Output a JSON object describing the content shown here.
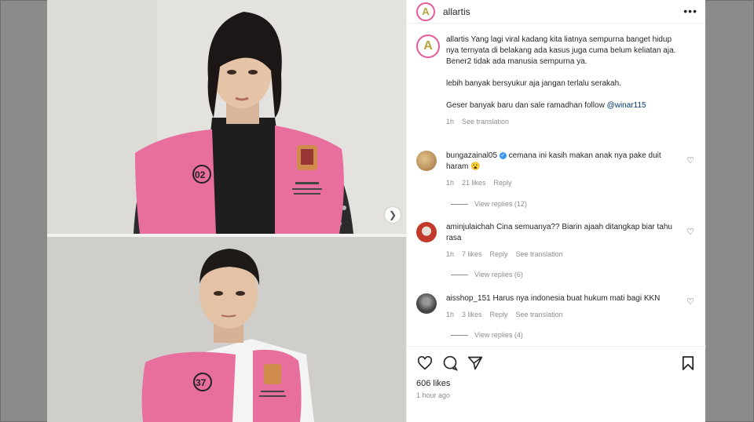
{
  "post": {
    "username": "allartis",
    "avatar_letter": "A",
    "more_icon": "more-horizontal-icon",
    "caption": {
      "username": "allartis",
      "line1": "Yang lagi viral kadang kita liatnya sempurna banget hidup nya ternyata di belakang ada kasus juga cuma belum keliatan aja.",
      "line2": "Bener2 tidak ada manusia sempurna ya.",
      "line3": "lebih banyak bersyukur aja jangan terlalu serakah.",
      "line4_prefix": "Geser banyak baru dan sale ramadhan follow ",
      "line4_mention": "@winar115",
      "time": "1h",
      "translation": "See translation"
    },
    "comments": [
      {
        "username": "bungazainal05",
        "verified": true,
        "text": "cemana ini kasih makan anak nya pake duit haram 😮",
        "time": "1h",
        "likes": "21 likes",
        "reply": "Reply",
        "translation": "",
        "view_replies": "View replies (12)",
        "avatar_color": "#c9a36b"
      },
      {
        "username": "aminjulaichah",
        "verified": false,
        "text": "Cina semuanya?? Biarin ajaah ditangkap biar tahu rasa",
        "time": "1h",
        "likes": "7 likes",
        "reply": "Reply",
        "translation": "See translation",
        "view_replies": "View replies (6)",
        "avatar_color": "#c0392b"
      },
      {
        "username": "aisshop_151",
        "verified": false,
        "text": "Harus nya indonesia buat hukum mati bagi KKN",
        "time": "1h",
        "likes": "3 likes",
        "reply": "Reply",
        "translation": "See translation",
        "view_replies": "View replies (4)",
        "avatar_color": "#555555"
      }
    ],
    "likes": "606 likes",
    "posted_ago": "1 hour ago",
    "badges": {
      "top_vest_number": "02",
      "bottom_vest_number": "37"
    },
    "colors": {
      "accent_ring": "#e75a9a",
      "vest_pink": "#e86e9d",
      "link": "#00376b"
    }
  }
}
